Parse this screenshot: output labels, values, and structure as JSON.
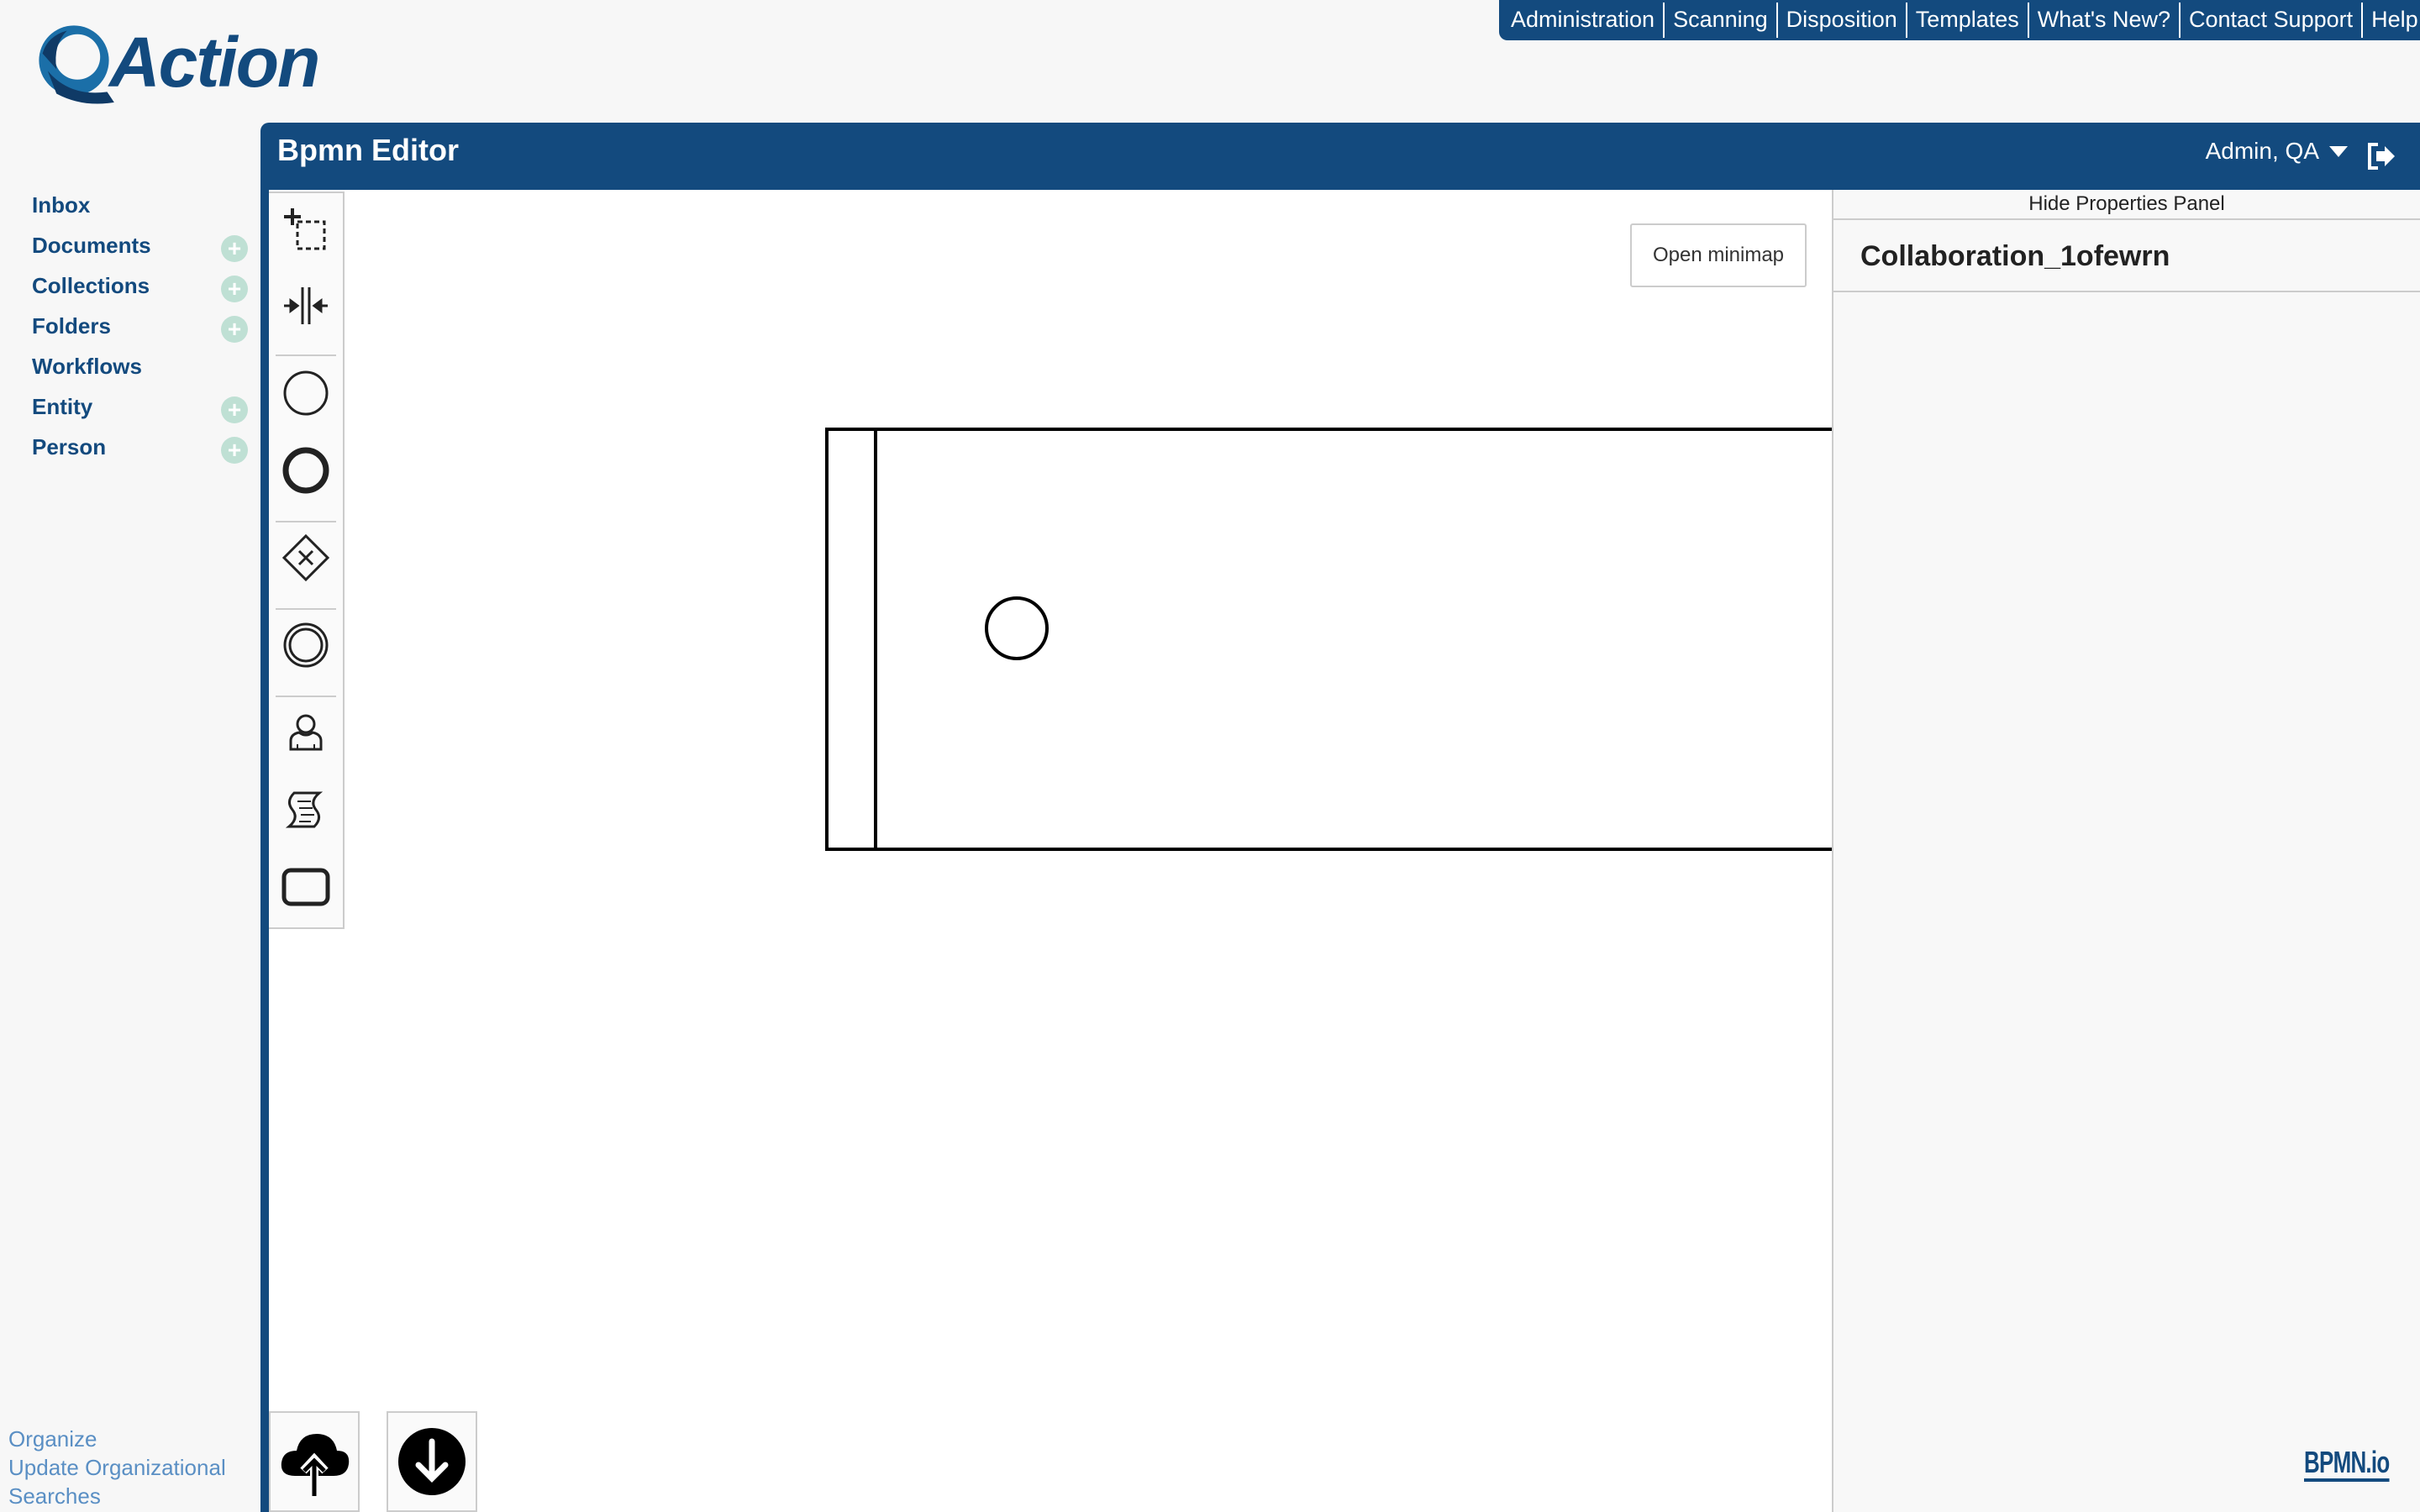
{
  "top_nav": {
    "items": [
      "Administration",
      "Scanning",
      "Disposition",
      "Templates",
      "What's New?",
      "Contact Support",
      "Help"
    ]
  },
  "logo": {
    "text": "Action",
    "icon": "q-logo-icon"
  },
  "sidebar": {
    "items": [
      {
        "label": "Inbox",
        "has_add": false
      },
      {
        "label": "Documents",
        "has_add": true
      },
      {
        "label": "Collections",
        "has_add": true
      },
      {
        "label": "Folders",
        "has_add": true
      },
      {
        "label": "Workflows",
        "has_add": false
      },
      {
        "label": "Entity",
        "has_add": true
      },
      {
        "label": "Person",
        "has_add": true
      }
    ],
    "add_symbol": "+",
    "bottom_links": [
      "Organize",
      "Update Organizational",
      "Searches"
    ]
  },
  "editor": {
    "title": "Bpmn Editor",
    "user": "Admin, QA",
    "minimap_label": "Open minimap",
    "palette_tools": [
      "lasso-tool-icon",
      "space-tool-icon",
      "start-event-icon",
      "end-event-icon",
      "gateway-icon",
      "intermediate-event-icon",
      "user-task-icon",
      "script-task-icon",
      "task-icon"
    ]
  },
  "properties": {
    "toggle_label": "Hide Properties Panel",
    "element_id": "Collaboration_1ofewrn"
  },
  "watermark": "BPMN.io",
  "colors": {
    "brand": "#134a7e",
    "accent_plus": "#bfe0d4",
    "link": "#5a8fc4"
  }
}
